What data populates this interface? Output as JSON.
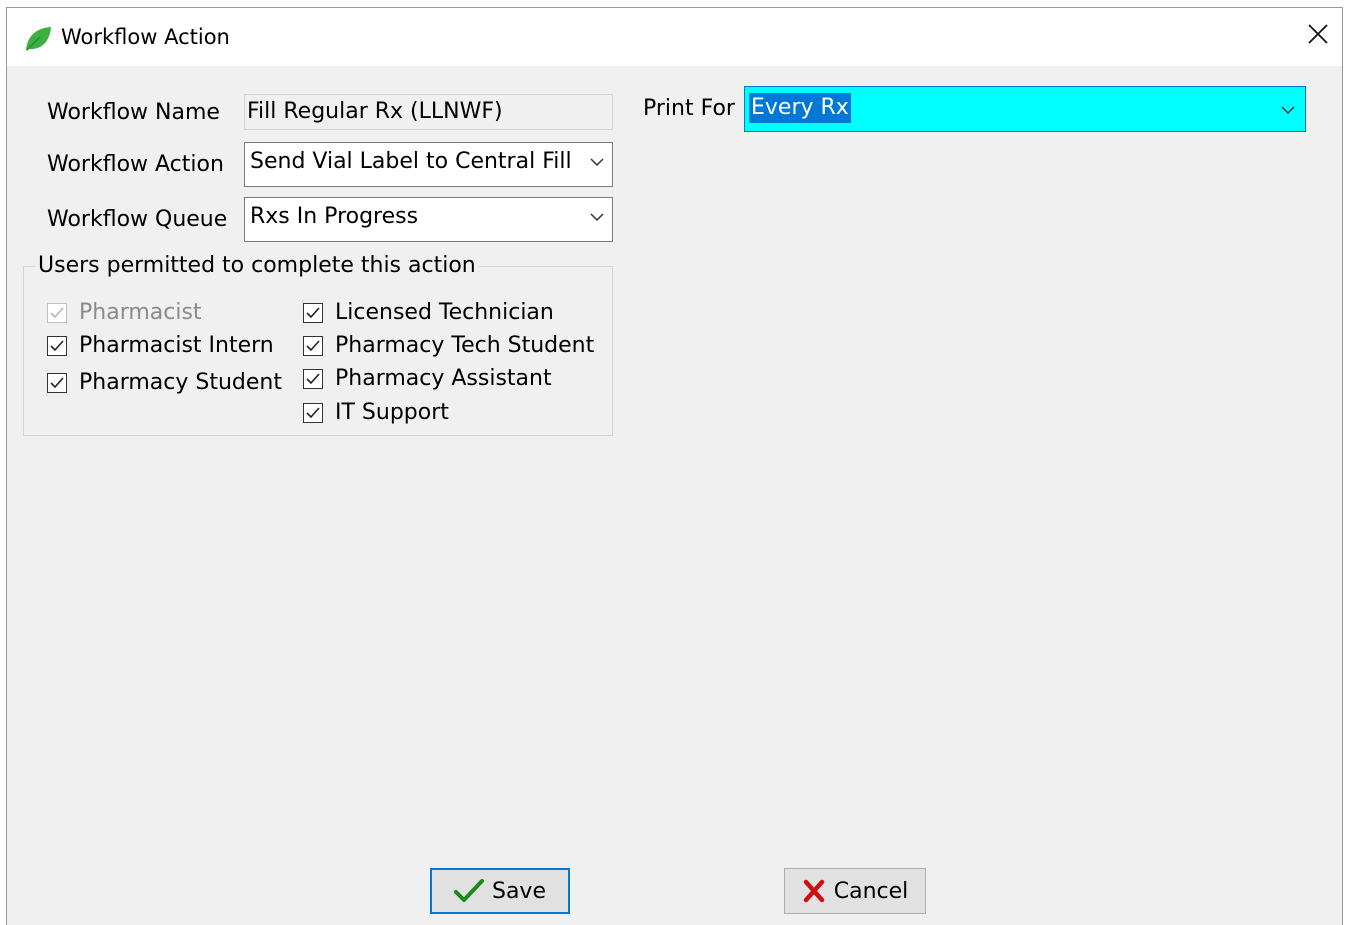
{
  "window": {
    "title": "Workflow Action",
    "icon": "leaf-icon",
    "close_icon": "close-icon"
  },
  "form": {
    "workflow_name_label": "Workflow Name",
    "workflow_name_value": "Fill Regular Rx (LLNWF)",
    "workflow_action_label": "Workflow Action",
    "workflow_action_value": "Send Vial Label to Central Fill",
    "workflow_queue_label": "Workflow Queue",
    "workflow_queue_value": "Rxs In Progress",
    "print_for_label": "Print For",
    "print_for_value": "Every Rx"
  },
  "users_group": {
    "legend": "Users permitted to complete this action",
    "left": [
      {
        "label": "Pharmacist",
        "checked": true,
        "disabled": true
      },
      {
        "label": "Pharmacist Intern",
        "checked": true,
        "disabled": false
      },
      {
        "label": "Pharmacy Student",
        "checked": true,
        "disabled": false
      }
    ],
    "right": [
      {
        "label": "Licensed Technician",
        "checked": true,
        "disabled": false
      },
      {
        "label": "Pharmacy Tech Student",
        "checked": true,
        "disabled": false
      },
      {
        "label": "Pharmacy Assistant",
        "checked": true,
        "disabled": false
      },
      {
        "label": "IT Support",
        "checked": true,
        "disabled": false
      }
    ]
  },
  "buttons": {
    "save_label": "Save",
    "cancel_label": "Cancel"
  },
  "colors": {
    "accent": "#0078d7",
    "print_for_bg": "#00ffff",
    "save_check": "#1a8a1a",
    "cancel_x": "#cc1111"
  }
}
